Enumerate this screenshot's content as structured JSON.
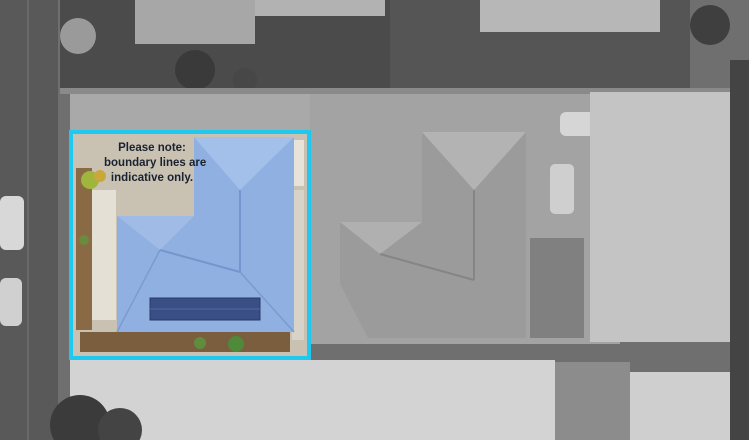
{
  "note": {
    "lines": [
      "Please note:",
      "boundary lines are",
      "indicative only."
    ]
  },
  "colors": {
    "boundary": "#1ec8ee",
    "roof": "#8fb0e0",
    "roof_ridge": "#7396cc",
    "solar_panel": "#3a4f86",
    "lot_ground": "#c9c2b3",
    "grayscale_roof": "#9a9a9a",
    "road": "#5a5a5a"
  },
  "icons": [
    "solar-panel-array",
    "garden-bed",
    "car"
  ]
}
